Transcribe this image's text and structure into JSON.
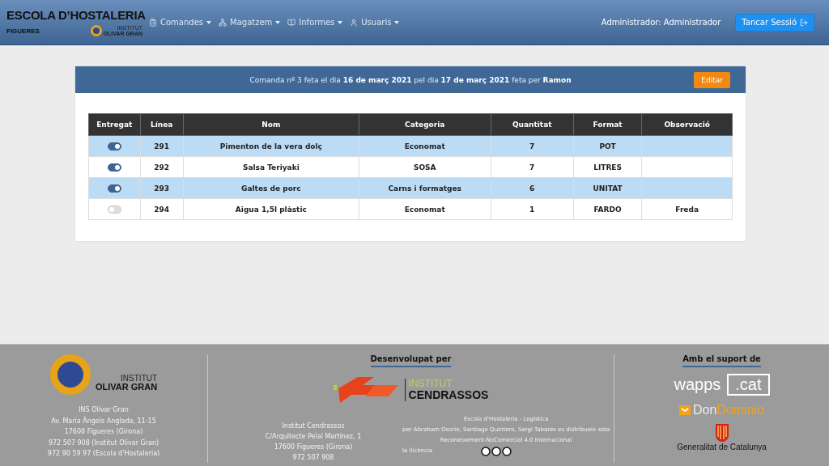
{
  "brand": {
    "title": "ESCOLA D’HOSTALERIA",
    "subtitle": "FIGUERES",
    "logo_top": "INSTITUT",
    "logo_bottom": "OLIVAR GRAN"
  },
  "nav": [
    {
      "label": "Comandes"
    },
    {
      "label": "Magatzem"
    },
    {
      "label": "Informes"
    },
    {
      "label": "Usuaris"
    }
  ],
  "user": "Administrador: Administrador",
  "logout": "Tancar Sessió",
  "order": {
    "summary": "Comanda nº 3 feta el dia **16 de març 2021** pel dia **17 de març 2021** feta per **Ramon**",
    "edit": "Editar"
  },
  "table": {
    "columns": [
      "Entregat",
      "Línea",
      "Nom",
      "Categoria",
      "Quantitat",
      "Format",
      "Observació"
    ],
    "rows": [
      {
        "checked": true,
        "cells": [
          "",
          "291",
          "Pimenton de la vera dolç",
          "Economat",
          "7",
          "POT",
          ""
        ]
      },
      {
        "checked": true,
        "cells": [
          "",
          "292",
          "Salsa Teriyaki",
          "SOSA",
          "7",
          "LITRES",
          ""
        ]
      },
      {
        "checked": true,
        "cells": [
          "",
          "293",
          "Galtes de porc",
          "Carns i formatges",
          "6",
          "UNITAT",
          ""
        ]
      },
      {
        "checked": false,
        "cells": [
          "",
          "294",
          "Aigua 1,5l plàstic",
          "Economat",
          "1",
          "FARDO",
          "Freda"
        ]
      }
    ]
  },
  "footer": {
    "school": {
      "logo_top": "INSTITUT",
      "logo_bottom": "OLIVAR GRAN",
      "lines": [
        "INS Olivar Gran",
        "Av. Maria Àngels Anglada, 11-15",
        "17600 Figueres (Girona)",
        "972 507 908 (Institut Olivar Gran)",
        "972 90 59 97 (Escola d'Hostaleria)"
      ]
    },
    "developer": {
      "title": "Desenvolupat per",
      "logo_top": "INSTITUT",
      "logo_bottom": "CENDRASSOS",
      "lines": [
        "Institut Cendrassos",
        "C/Arquitecte Pelai Martínez, 1",
        "17600 Figueres (Girona)",
        "972 507 908"
      ],
      "license": [
        "Escola d'Hostaleria - Logística",
        "per Abraham Osorio, Santiago Quintero, Sergi Tabares es distribueix sota",
        "Reconeixement-NoComercial 4.0 Internacional"
      ],
      "license_word": "la llicència"
    },
    "support": {
      "title": "Amb el suport de",
      "wapps": "wapps",
      "cat": ".cat",
      "don": "Don",
      "dominio": "Dominio",
      "generalitat": "Generalitat de Catalunya"
    }
  }
}
